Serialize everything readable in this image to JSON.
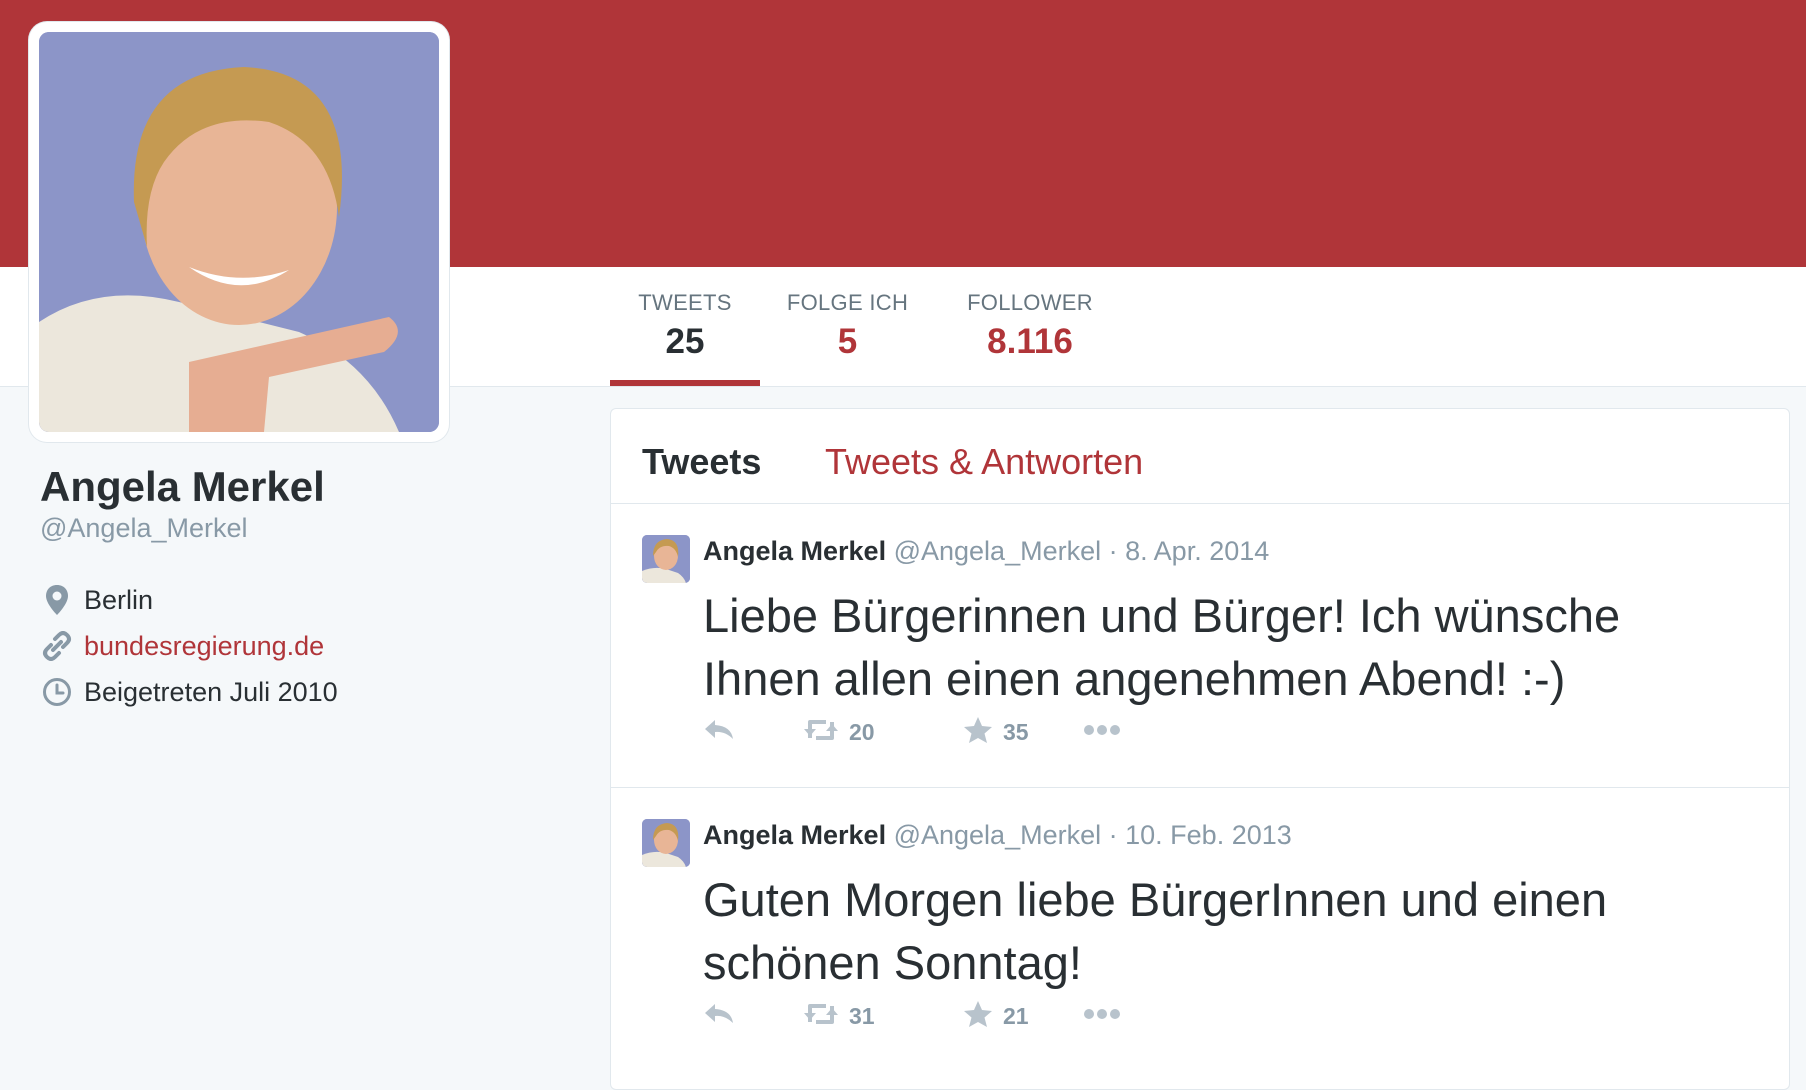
{
  "colors": {
    "brand": "#b03539",
    "muted": "#8899a6",
    "text": "#292f33"
  },
  "profile": {
    "name": "Angela Merkel",
    "handle": "@Angela_Merkel",
    "location": "Berlin",
    "url": "bundesregierung.de",
    "joined": "Beigetreten Juli 2010"
  },
  "stats": [
    {
      "label": "TWEETS",
      "value": "25"
    },
    {
      "label": "FOLGE ICH",
      "value": "5"
    },
    {
      "label": "FOLLOWER",
      "value": "8.116"
    }
  ],
  "tabs": [
    {
      "label": "Tweets",
      "active": true
    },
    {
      "label": "Tweets & Antworten",
      "active": false
    }
  ],
  "tweets": [
    {
      "name": "Angela Merkel",
      "handle": "@Angela_Merkel",
      "separator": "·",
      "date": "8. Apr. 2014",
      "text": "Liebe Bürgerinnen und Bürger! Ich wünsche Ihnen allen einen angenehmen Abend! :-)",
      "retweets": "20",
      "favorites": "35"
    },
    {
      "name": "Angela Merkel",
      "handle": "@Angela_Merkel",
      "separator": "·",
      "date": "10. Feb. 2013",
      "text": "Guten Morgen liebe BürgerInnen und einen schönen Sonntag!",
      "retweets": "31",
      "favorites": "21"
    }
  ],
  "icons": {
    "location": "map-pin-icon",
    "url": "link-icon",
    "joined": "clock-icon",
    "reply": "reply-icon",
    "retweet": "retweet-icon",
    "favorite": "star-icon",
    "more": "more-dots-icon"
  }
}
